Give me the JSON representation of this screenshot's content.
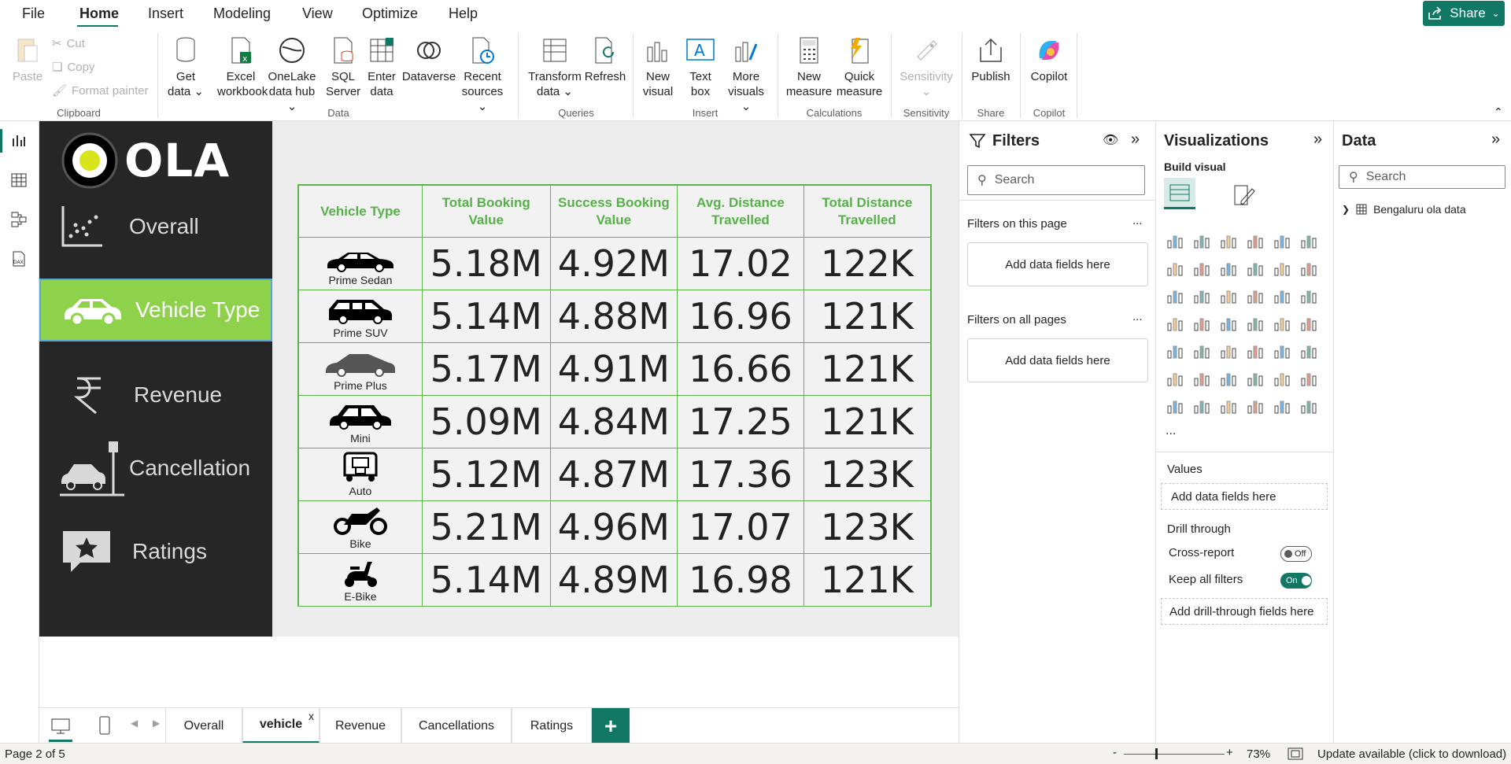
{
  "menu": {
    "items": [
      "File",
      "Home",
      "Insert",
      "Modeling",
      "View",
      "Optimize",
      "Help"
    ],
    "share_label": "Share"
  },
  "ribbon": {
    "clipboard": {
      "paste": "Paste",
      "cut": "Cut",
      "copy": "Copy",
      "format_painter": "Format painter",
      "group": "Clipboard"
    },
    "data": {
      "get_data": [
        "Get",
        "data"
      ],
      "excel": [
        "Excel",
        "workbook"
      ],
      "onelake": [
        "OneLake",
        "data hub"
      ],
      "sql": [
        "SQL",
        "Server"
      ],
      "enter": [
        "Enter",
        "data"
      ],
      "dataverse": "Dataverse",
      "recent": [
        "Recent",
        "sources"
      ],
      "group": "Data"
    },
    "queries": {
      "transform": [
        "Transform",
        "data"
      ],
      "refresh": "Refresh",
      "group": "Queries"
    },
    "insert": {
      "new_visual": [
        "New",
        "visual"
      ],
      "text_box": [
        "Text",
        "box"
      ],
      "more_visuals": [
        "More",
        "visuals"
      ],
      "group": "Insert"
    },
    "calculations": {
      "new_measure": [
        "New",
        "measure"
      ],
      "quick_measure": [
        "Quick",
        "measure"
      ],
      "group": "Calculations"
    },
    "sensitivity": {
      "label": "Sensitivity",
      "group": "Sensitivity"
    },
    "share": {
      "publish": "Publish",
      "group": "Share"
    },
    "copilot": {
      "label": "Copilot",
      "group": "Copilot"
    }
  },
  "report": {
    "logo_text": "OLA",
    "nav": [
      "Overall",
      "Vehicle Type",
      "Revenue",
      "Cancellation",
      "Ratings"
    ],
    "table": {
      "headers": [
        [
          "Vehicle Type"
        ],
        [
          "Total Booking",
          "Value"
        ],
        [
          "Success Booking",
          "Value"
        ],
        [
          "Avg. Distance",
          "Travelled"
        ],
        [
          "Total Distance",
          "Travelled"
        ]
      ],
      "rows": [
        {
          "vehicle": "Prime Sedan",
          "total_booking": "5.18M",
          "success_booking": "4.92M",
          "avg_distance": "17.02",
          "total_distance": "122K"
        },
        {
          "vehicle": "Prime SUV",
          "total_booking": "5.14M",
          "success_booking": "4.88M",
          "avg_distance": "16.96",
          "total_distance": "121K"
        },
        {
          "vehicle": "Prime Plus",
          "total_booking": "5.17M",
          "success_booking": "4.91M",
          "avg_distance": "16.66",
          "total_distance": "121K"
        },
        {
          "vehicle": "Mini",
          "total_booking": "5.09M",
          "success_booking": "4.84M",
          "avg_distance": "17.25",
          "total_distance": "121K"
        },
        {
          "vehicle": "Auto",
          "total_booking": "5.12M",
          "success_booking": "4.87M",
          "avg_distance": "17.36",
          "total_distance": "123K"
        },
        {
          "vehicle": "Bike",
          "total_booking": "5.21M",
          "success_booking": "4.96M",
          "avg_distance": "17.07",
          "total_distance": "123K"
        },
        {
          "vehicle": "E-Bike",
          "total_booking": "5.14M",
          "success_booking": "4.89M",
          "avg_distance": "16.98",
          "total_distance": "121K"
        }
      ]
    }
  },
  "tabs": [
    "Overall",
    "vehicle",
    "Revenue",
    "Cancellations",
    "Ratings"
  ],
  "tab_close": "x",
  "status": {
    "page": "Page 2 of 5",
    "zoom": "73%",
    "update": "Update available (click to download)"
  },
  "filters": {
    "title": "Filters",
    "search_placeholder": "Search",
    "on_this_page": "Filters on this page",
    "on_all_pages": "Filters on all pages",
    "add_fields": "Add data fields here",
    "more": "..."
  },
  "visualizations": {
    "title": "Visualizations",
    "build_visual": "Build visual",
    "values": "Values",
    "add_fields": "Add data fields here",
    "drill_through": "Drill through",
    "cross_report": "Cross-report",
    "cross_report_state": "Off",
    "keep_all_filters": "Keep all filters",
    "keep_all_state": "On",
    "add_drill": "Add drill-through fields here",
    "more": "..."
  },
  "data_pane": {
    "title": "Data",
    "search_placeholder": "Search",
    "tables": [
      "Bengaluru ola data"
    ]
  },
  "colors": {
    "accent": "#117865",
    "nav_active": "#8ed14b",
    "table_green": "#5fb34b",
    "nav_bg": "#262626"
  }
}
